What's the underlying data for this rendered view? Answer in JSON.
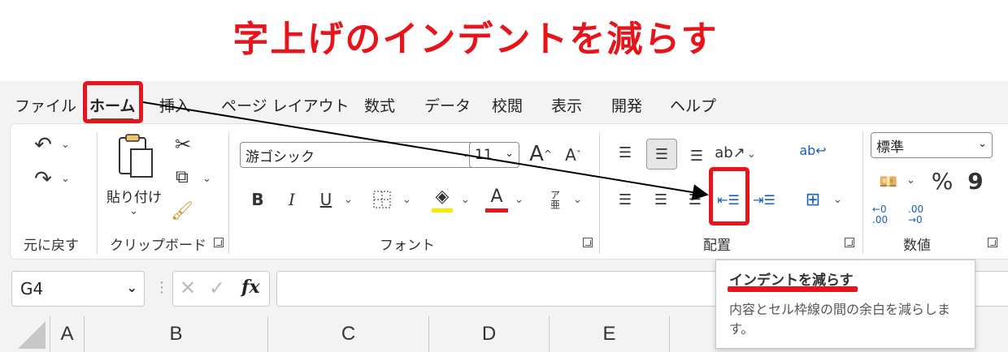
{
  "title": "字上げのインデントを減らす",
  "tabs": [
    {
      "label": "ファイル"
    },
    {
      "label": "ホーム"
    },
    {
      "label": "挿入"
    },
    {
      "label": "ページ レイアウト"
    },
    {
      "label": "数式"
    },
    {
      "label": "データ"
    },
    {
      "label": "校閲"
    },
    {
      "label": "表示"
    },
    {
      "label": "開発"
    },
    {
      "label": "ヘルプ"
    }
  ],
  "ribbon": {
    "undo_group_label": "元に戻す",
    "clipboard": {
      "paste_label": "貼り付け",
      "group_label": "クリップボード"
    },
    "font": {
      "font_name": "游ゴシック",
      "font_size": "11",
      "group_label": "フォント",
      "bold": "B",
      "italic": "I",
      "underline": "U",
      "font_color_letter": "A",
      "phonetic": "ア亜",
      "highlight_color": "#ffe600",
      "font_color": "#e8141b"
    },
    "alignment": {
      "group_label": "配置"
    },
    "number": {
      "format": "標準",
      "group_label": "数値",
      "percent": "%",
      "comma": "9",
      "inc_decimal": "←0 .00",
      "dec_decimal": ".00 →0"
    }
  },
  "formula_bar": {
    "cell_ref": "G4",
    "fx": "fx"
  },
  "columns": [
    "A",
    "B",
    "C",
    "D",
    "E"
  ],
  "tooltip": {
    "title": "インデントを減らす",
    "description": "内容とセル枠線の間の余白を減らします。"
  },
  "colors": {
    "accent_red": "#e8141b",
    "excel_green": "#1e7145"
  }
}
